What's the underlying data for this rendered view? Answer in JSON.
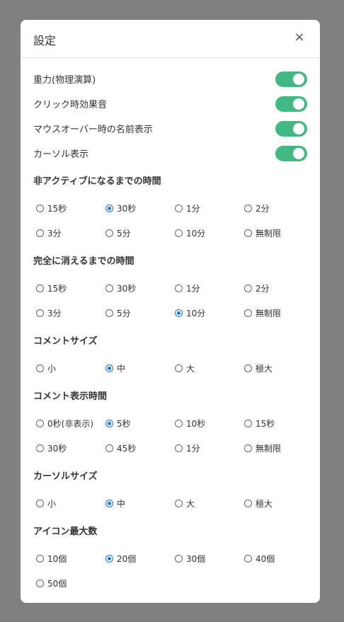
{
  "modal": {
    "title": "設定",
    "close_label": "×"
  },
  "toggles": [
    {
      "label": "重力(物理演算)",
      "on": true
    },
    {
      "label": "クリック時効果音",
      "on": true
    },
    {
      "label": "マウスオーバー時の名前表示",
      "on": true
    },
    {
      "label": "カーソル表示",
      "on": true
    }
  ],
  "sections": [
    {
      "title": "非アクティブになるまでの時間",
      "options": [
        "15秒",
        "30秒",
        "1分",
        "2分",
        "3分",
        "5分",
        "10分",
        "無制限"
      ],
      "selected": 1
    },
    {
      "title": "完全に消えるまでの時間",
      "options": [
        "15秒",
        "30秒",
        "1分",
        "2分",
        "3分",
        "5分",
        "10分",
        "無制限"
      ],
      "selected": 6
    },
    {
      "title": "コメントサイズ",
      "options": [
        "小",
        "中",
        "大",
        "極大"
      ],
      "selected": 1
    },
    {
      "title": "コメント表示時間",
      "options": [
        "0秒(非表示)",
        "5秒",
        "10秒",
        "15秒",
        "30秒",
        "45秒",
        "1分",
        "無制限"
      ],
      "selected": 1
    },
    {
      "title": "カーソルサイズ",
      "options": [
        "小",
        "中",
        "大",
        "極大"
      ],
      "selected": 1
    },
    {
      "title": "アイコン最大数",
      "options": [
        "10個",
        "20個",
        "30個",
        "40個",
        "50個"
      ],
      "selected": 1
    }
  ],
  "colors": {
    "toggle_on": "#42b983",
    "radio_checked": "#1a73e8",
    "overlay": "#808080"
  }
}
